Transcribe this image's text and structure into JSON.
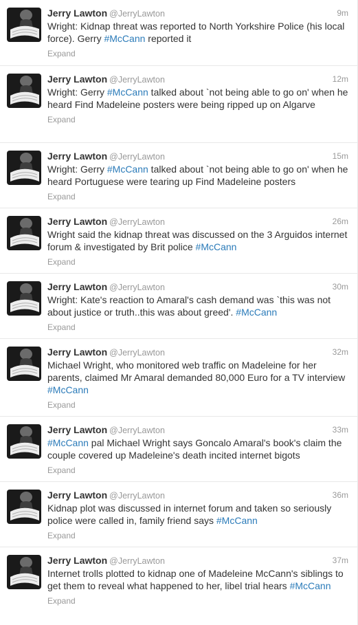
{
  "tweets": [
    {
      "name": "Jerry Lawton",
      "handle": "@JerryLawton",
      "time": "9m",
      "text_parts": [
        "Wright: Kidnap threat was reported to North Yorkshire Police (his local force). Gerry ",
        "#McCann",
        " reported it"
      ],
      "expand": "Expand"
    },
    {
      "name": "Jerry Lawton",
      "handle": "@JerryLawton",
      "time": "12m",
      "text_parts": [
        "Wright: Gerry ",
        "#McCann",
        " talked about `not being able to go on' when he heard Find Madeleine posters were being ripped up on Algarve"
      ],
      "expand": "Expand"
    },
    {
      "name": "Jerry Lawton",
      "handle": "@JerryLawton",
      "time": "15m",
      "text_parts": [
        "Wright: Gerry ",
        "#McCann",
        " talked about `not being able to go on' when he heard Portuguese were tearing up Find Madeleine posters"
      ],
      "expand": "Expand"
    },
    {
      "name": "Jerry Lawton",
      "handle": "@JerryLawton",
      "time": "26m",
      "text_parts": [
        "Wright said the kidnap threat was discussed on the 3 Arguidos internet forum & investigated by Brit police ",
        "#McCann",
        ""
      ],
      "expand": "Expand"
    },
    {
      "name": "Jerry Lawton",
      "handle": "@JerryLawton",
      "time": "30m",
      "text_parts": [
        "Wright: Kate's reaction to Amaral's cash demand was `this was not about justice or truth..this was about greed'. ",
        "#McCann",
        ""
      ],
      "expand": "Expand"
    },
    {
      "name": "Jerry Lawton",
      "handle": "@JerryLawton",
      "time": "32m",
      "text_parts": [
        "Michael Wright, who monitored web traffic on Madeleine for her parents, claimed Mr Amaral demanded 80,000 Euro for a TV interview ",
        "#McCann",
        ""
      ],
      "expand": "Expand"
    },
    {
      "name": "Jerry Lawton",
      "handle": "@JerryLawton",
      "time": "33m",
      "text_parts": [
        "",
        "#McCann",
        " pal Michael Wright says Goncalo Amaral's book's claim the couple covered up Madeleine's death incited internet bigots"
      ],
      "expand": "Expand"
    },
    {
      "name": "Jerry Lawton",
      "handle": "@JerryLawton",
      "time": "36m",
      "text_parts": [
        "Kidnap plot was discussed in internet forum and taken so seriously police were called in, family friend says ",
        "#McCann",
        ""
      ],
      "expand": "Expand"
    },
    {
      "name": "Jerry Lawton",
      "handle": "@JerryLawton",
      "time": "37m",
      "text_parts": [
        "Internet trolls plotted to kidnap one of Madeleine McCann's siblings to get them to reveal what happened to her, libel trial hears ",
        "#McCann",
        ""
      ],
      "expand": "Expand"
    }
  ]
}
